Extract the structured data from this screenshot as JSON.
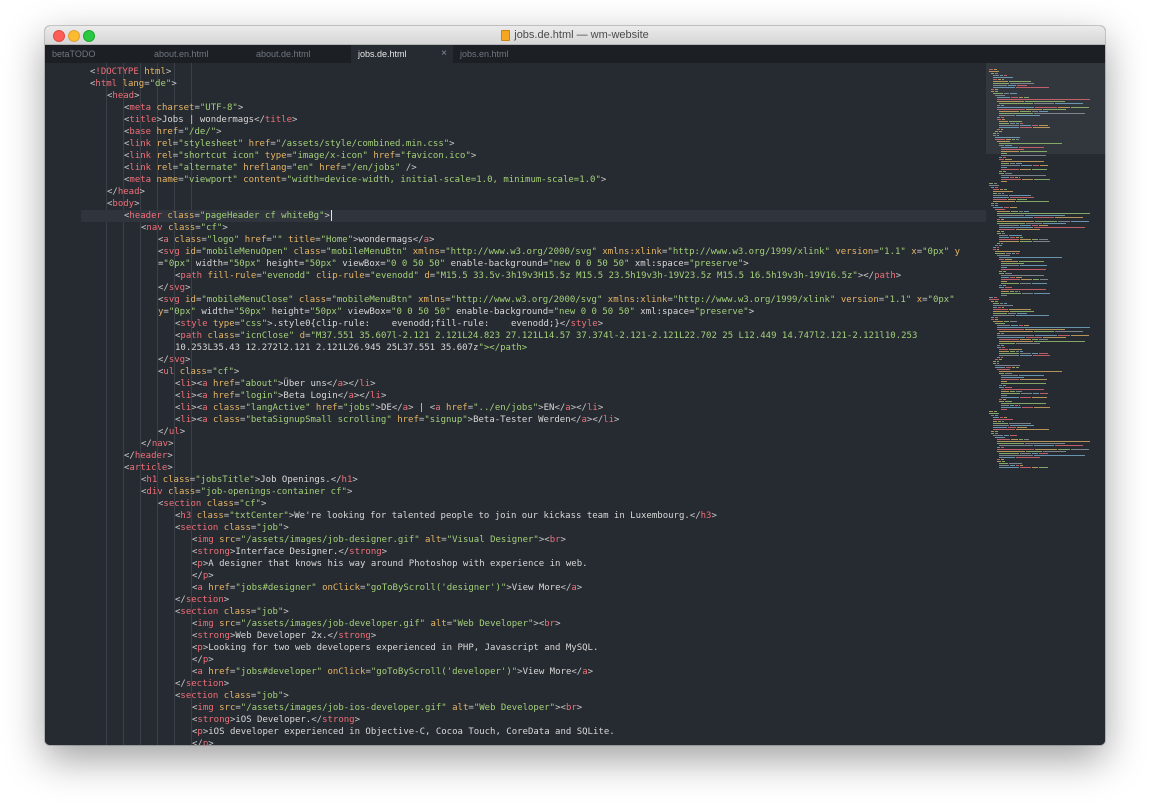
{
  "window": {
    "title": "jobs.de.html — wm-website"
  },
  "tabs": [
    {
      "label": "betaTODO",
      "active": false
    },
    {
      "label": "about.en.html",
      "active": false
    },
    {
      "label": "about.de.html",
      "active": false
    },
    {
      "label": "jobs.de.html",
      "active": true,
      "close_icon": "×"
    },
    {
      "label": "jobs.en.html",
      "active": false
    }
  ],
  "colors": {
    "editor_bg": "#262a31",
    "tab_bar_bg": "#1c1f24",
    "gutter_fg": "#6f7780",
    "tag": "#f16f78",
    "attr": "#e6b565",
    "string": "#a3d07a",
    "text": "#d8d8d8"
  },
  "editor": {
    "current_line": 13,
    "lines": [
      {
        "n": "1",
        "indent": 0,
        "text": "<!DOCTYPE html>"
      },
      {
        "n": "2",
        "indent": 0,
        "text": "<html lang=\"de\">"
      },
      {
        "n": "3",
        "indent": 1,
        "text": "<head>"
      },
      {
        "n": "4",
        "indent": 2,
        "text": "<meta charset=\"UTF-8\">"
      },
      {
        "n": "5",
        "indent": 2,
        "text": "<title>Jobs | wondermags</title>"
      },
      {
        "n": "6",
        "indent": 2,
        "text": "<base href=\"/de/\">"
      },
      {
        "n": "7",
        "indent": 2,
        "text": "<link rel=\"stylesheet\" href=\"/assets/style/combined.min.css\">"
      },
      {
        "n": "8",
        "indent": 2,
        "text": "<link rel=\"shortcut icon\" type=\"image/x-icon\" href=\"favicon.ico\">"
      },
      {
        "n": "9",
        "indent": 2,
        "text": "<link rel=\"alternate\" hreflang=\"en\" href=\"/en/jobs\" />"
      },
      {
        "n": "10",
        "indent": 2,
        "text": "<meta name=\"viewport\" content=\"width=device-width, initial-scale=1.0, minimum-scale=1.0\">"
      },
      {
        "n": "11",
        "indent": 1,
        "text": "</head>"
      },
      {
        "n": "12",
        "indent": 1,
        "text": "<body>"
      },
      {
        "n": "13",
        "indent": 2,
        "text": "<header class=\"pageHeader cf whiteBg\">"
      },
      {
        "n": "14",
        "indent": 3,
        "text": "<nav class=\"cf\">"
      },
      {
        "n": "15",
        "indent": 4,
        "text": "<a class=\"logo\" href=\"\" title=\"Home\">wondermags</a>"
      },
      {
        "n": "16",
        "indent": 4,
        "text": "<svg id=\"mobileMenuOpen\" class=\"mobileMenuBtn\" xmlns=\"http://www.w3.org/2000/svg\" xmlns:xlink=\"http://www.w3.org/1999/xlink\" version=\"1.1\" x=\"0px\" y"
      },
      {
        "n": "",
        "indent": 4,
        "text": "=\"0px\" width=\"50px\" height=\"50px\" viewBox=\"0 0 50 50\" enable-background=\"new 0 0 50 50\" xml:space=\"preserve\">"
      },
      {
        "n": "17",
        "indent": 5,
        "text": "<path fill-rule=\"evenodd\" clip-rule=\"evenodd\" d=\"M15.5 33.5v-3h19v3H15.5z M15.5 23.5h19v3h-19V23.5z M15.5 16.5h19v3h-19V16.5z\"></path>"
      },
      {
        "n": "18",
        "indent": 4,
        "text": "</svg>"
      },
      {
        "n": "19",
        "indent": 4,
        "text": "<svg id=\"mobileMenuClose\" class=\"mobileMenuBtn\" xmlns=\"http://www.w3.org/2000/svg\" xmlns:xlink=\"http://www.w3.org/1999/xlink\" version=\"1.1\" x=\"0px\""
      },
      {
        "n": "",
        "indent": 4,
        "text": "y=\"0px\" width=\"50px\" height=\"50px\" viewBox=\"0 0 50 50\" enable-background=\"new 0 0 50 50\" xml:space=\"preserve\">"
      },
      {
        "n": "20",
        "indent": 5,
        "text": "<style type=\"css\">.style0{clip-rule:    evenodd;fill-rule:    evenodd;}</style>"
      },
      {
        "n": "21",
        "indent": 5,
        "text": "<path class=\"icnClose\" d=\"M37.551 35.607l-2.121 2.121L24.823 27.121L14.57 37.374l-2.121-2.121L22.702 25 L12.449 14.747l2.121-2.121l10.253"
      },
      {
        "n": "",
        "indent": 5,
        "text": "10.253L35.43 12.272l2.121 2.121L26.945 25L37.551 35.607z\"></path>"
      },
      {
        "n": "22",
        "indent": 4,
        "text": "</svg>"
      },
      {
        "n": "23",
        "indent": 4,
        "text": "<ul class=\"cf\">"
      },
      {
        "n": "24",
        "indent": 5,
        "text": "<li><a href=\"about\">Über uns</a></li>"
      },
      {
        "n": "25",
        "indent": 5,
        "text": "<li><a href=\"login\">Beta Login</a></li>"
      },
      {
        "n": "26",
        "indent": 5,
        "text": "<li><a class=\"langActive\" href=\"jobs\">DE</a> | <a href=\"../en/jobs\">EN</a></li>"
      },
      {
        "n": "27",
        "indent": 5,
        "text": "<li><a class=\"betaSignupSmall scrolling\" href=\"signup\">Beta-Tester Werden</a></li>"
      },
      {
        "n": "28",
        "indent": 4,
        "text": "</ul>"
      },
      {
        "n": "29",
        "indent": 3,
        "text": "</nav>"
      },
      {
        "n": "30",
        "indent": 2,
        "text": "</header>"
      },
      {
        "n": "31",
        "indent": 2,
        "text": "<article>"
      },
      {
        "n": "32",
        "indent": 3,
        "text": "<h1 class=\"jobsTitle\">Job Openings.</h1>"
      },
      {
        "n": "33",
        "indent": 3,
        "text": "<div class=\"job-openings-container cf\">"
      },
      {
        "n": "34",
        "indent": 4,
        "text": "<section class=\"cf\">"
      },
      {
        "n": "35",
        "indent": 5,
        "text": "<h3 class=\"txtCenter\">We're looking for talented people to join our kickass team in Luxembourg.</h3>"
      },
      {
        "n": "36",
        "indent": 5,
        "text": "<section class=\"job\">"
      },
      {
        "n": "37",
        "indent": 6,
        "text": "<img src=\"/assets/images/job-designer.gif\" alt=\"Visual Designer\"><br>"
      },
      {
        "n": "38",
        "indent": 6,
        "text": "<strong>Interface Designer.</strong>"
      },
      {
        "n": "39",
        "indent": 6,
        "text": "<p>A designer that knows his way around Photoshop with experience in web."
      },
      {
        "n": "40",
        "indent": 6,
        "text": "</p>"
      },
      {
        "n": "41",
        "indent": 6,
        "text": "<a href=\"jobs#designer\" onClick=\"goToByScroll('designer')\">View More</a>"
      },
      {
        "n": "42",
        "indent": 5,
        "text": "</section>"
      },
      {
        "n": "43",
        "indent": 5,
        "text": "<section class=\"job\">"
      },
      {
        "n": "44",
        "indent": 6,
        "text": "<img src=\"/assets/images/job-developer.gif\" alt=\"Web Developer\"><br>"
      },
      {
        "n": "45",
        "indent": 6,
        "text": "<strong>Web Developer 2x.</strong>"
      },
      {
        "n": "46",
        "indent": 6,
        "text": "<p>Looking for two web developers experienced in PHP, Javascript and MySQL."
      },
      {
        "n": "47",
        "indent": 6,
        "text": "</p>"
      },
      {
        "n": "48",
        "indent": 6,
        "text": "<a href=\"jobs#developer\" onClick=\"goToByScroll('developer')\">View More</a>"
      },
      {
        "n": "49",
        "indent": 5,
        "text": "</section>"
      },
      {
        "n": "50",
        "indent": 5,
        "text": "<section class=\"job\">"
      },
      {
        "n": "51",
        "indent": 6,
        "text": "<img src=\"/assets/images/job-ios-developer.gif\" alt=\"Web Developer\"><br>"
      },
      {
        "n": "52",
        "indent": 6,
        "text": "<strong>iOS Developer.</strong>"
      },
      {
        "n": "53",
        "indent": 6,
        "text": "<p>iOS developer experienced in Objective-C, Cocoa Touch, CoreData and SQLite."
      },
      {
        "n": "54",
        "indent": 6,
        "text": "</p>"
      }
    ]
  }
}
